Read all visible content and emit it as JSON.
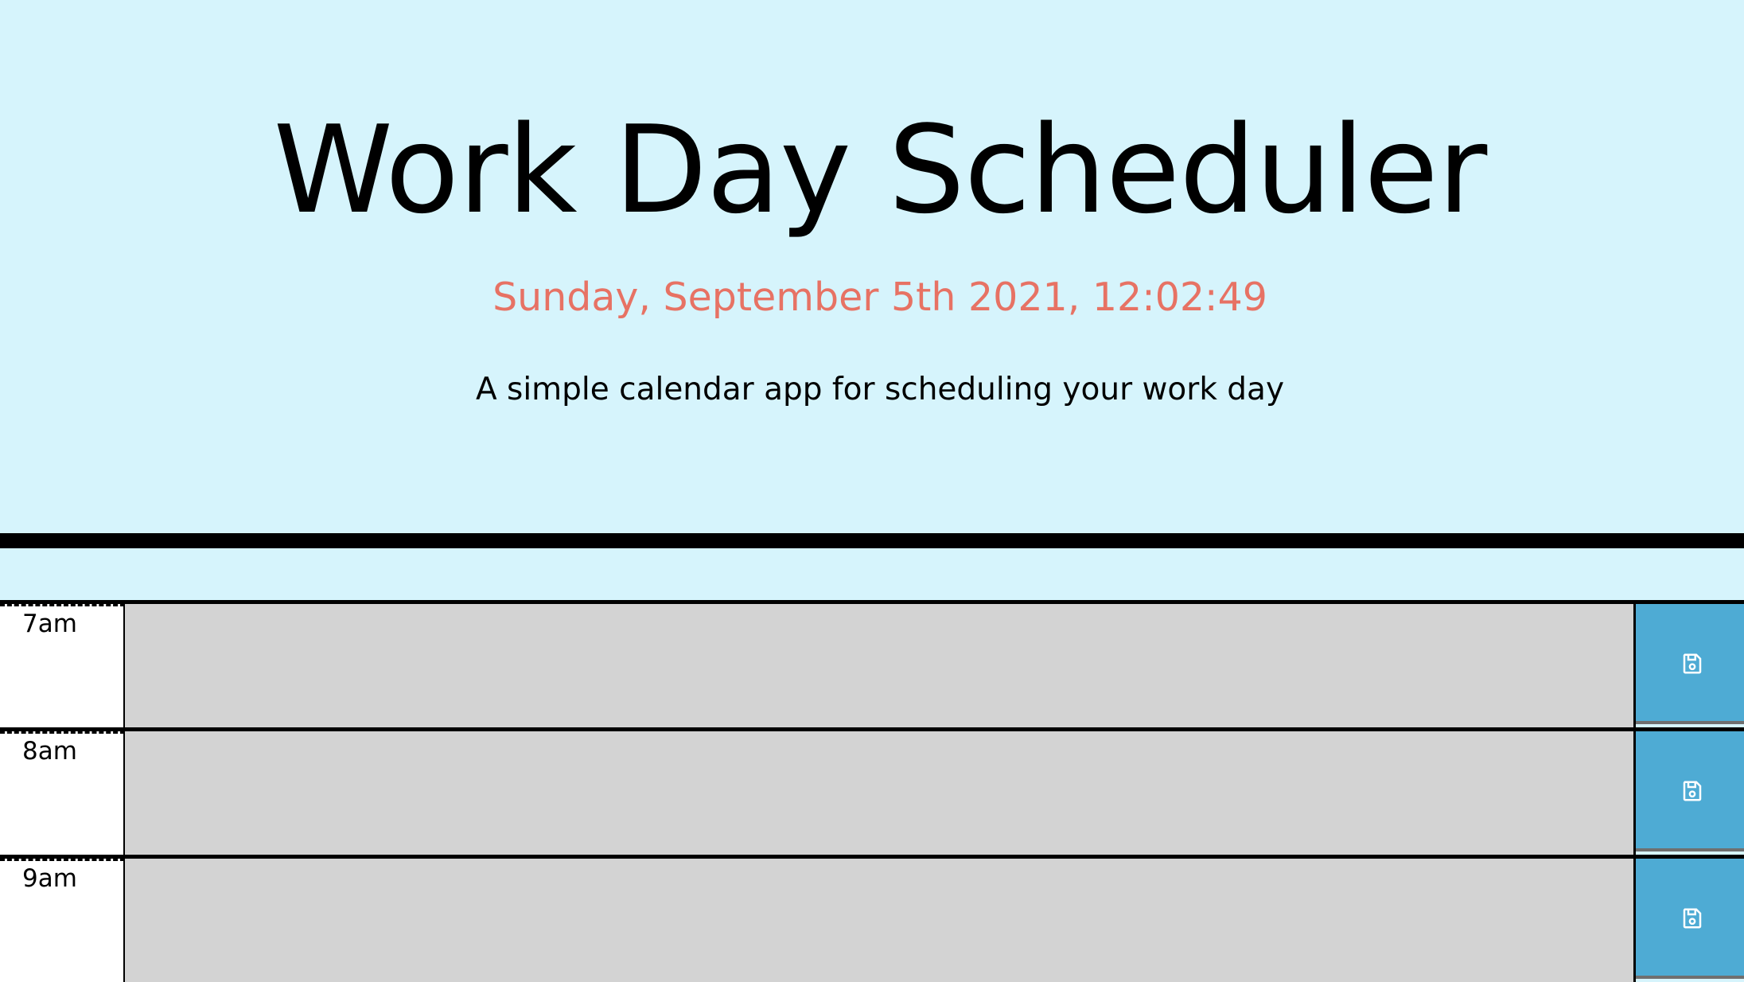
{
  "header": {
    "title": "Work Day Scheduler",
    "current_datetime": "Sunday, September 5th 2021, 12:02:49",
    "lead": "A simple calendar app for scheduling your work day"
  },
  "colors": {
    "background": "#d6f4fc",
    "datetime_text": "#e77264",
    "past_block": "#d3d3d3",
    "save_button": "#4eabd4"
  },
  "time_blocks": [
    {
      "hour_label": "7am",
      "description": "",
      "status": "past",
      "save_icon": "floppy-disk-icon"
    },
    {
      "hour_label": "8am",
      "description": "",
      "status": "past",
      "save_icon": "floppy-disk-icon"
    },
    {
      "hour_label": "9am",
      "description": "",
      "status": "past",
      "save_icon": "floppy-disk-icon"
    }
  ]
}
